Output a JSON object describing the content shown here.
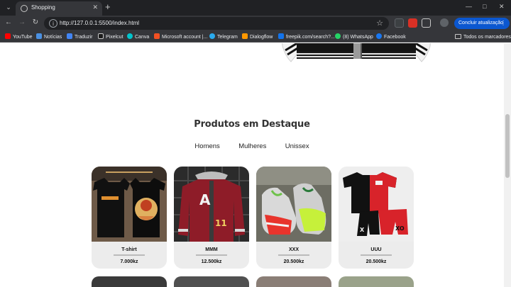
{
  "browser": {
    "tab_title": "Shopping",
    "url": "http://127.0.0.1:5500/index.html",
    "update_button": "Concluir atualização",
    "bookmarks": [
      {
        "label": "YouTube",
        "color": "#ff0000"
      },
      {
        "label": "Notícias",
        "color": "#4a90e2"
      },
      {
        "label": "Traduzir",
        "color": "#4285f4"
      },
      {
        "label": "Pixelcut",
        "color": "#1c1c1c"
      },
      {
        "label": "Canva",
        "color": "#00c4cc"
      },
      {
        "label": "Microsoft account |...",
        "color": "#f25022"
      },
      {
        "label": "Telegram",
        "color": "#2aabee"
      },
      {
        "label": "Dialogflow",
        "color": "#ff9800"
      },
      {
        "label": "freepik.com/search?...",
        "color": "#1273eb"
      },
      {
        "label": "(8) WhatsApp",
        "color": "#25d366"
      },
      {
        "label": "Facebook",
        "color": "#1877f2"
      }
    ],
    "bookmarks_folder": "Todos os marcadores"
  },
  "page": {
    "section_title": "Produtos em Destaque",
    "filters": [
      "Homens",
      "Mulheres",
      "Unissex"
    ],
    "products": [
      {
        "name": "T-shirt",
        "price": "7.000kz"
      },
      {
        "name": "MMM",
        "price": "12.500kz"
      },
      {
        "name": "XXX",
        "price": "20.500kz"
      },
      {
        "name": "UUU",
        "price": "20.500kz"
      }
    ]
  },
  "colors": {
    "chrome_dark": "#202124",
    "chrome_mid": "#35363a",
    "update_blue": "#0b57d0",
    "card_bg": "#ececec"
  }
}
